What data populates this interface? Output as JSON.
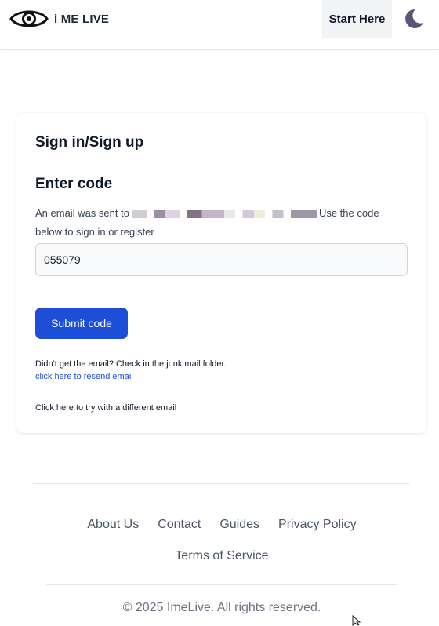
{
  "header": {
    "brand": "i ME LIVE",
    "start_label": "Start Here",
    "logo_icon": "eye-icon",
    "theme_icon": "moon-icon"
  },
  "auth": {
    "title": "Sign in/Sign up",
    "subtitle": "Enter code",
    "description_before": "An email was sent to",
    "description_after": "Use the code below to sign in or register",
    "code_value": "055079",
    "submit_label": "Submit code",
    "junk_note": "Didn't get the email? Check in the junk mail folder.",
    "resend_label": "click here to resend email",
    "different_email_label": "Click here to try with a different email"
  },
  "footer": {
    "links": [
      "About Us",
      "Contact",
      "Guides",
      "Privacy Policy",
      "Terms of Service"
    ],
    "copyright": "© 2025 ImeLive. All rights reserved."
  },
  "colors": {
    "primary": "#1d4ed8",
    "link": "#1d4ed8",
    "start_bg": "#f3f4f6",
    "moon": "#5b5678"
  }
}
